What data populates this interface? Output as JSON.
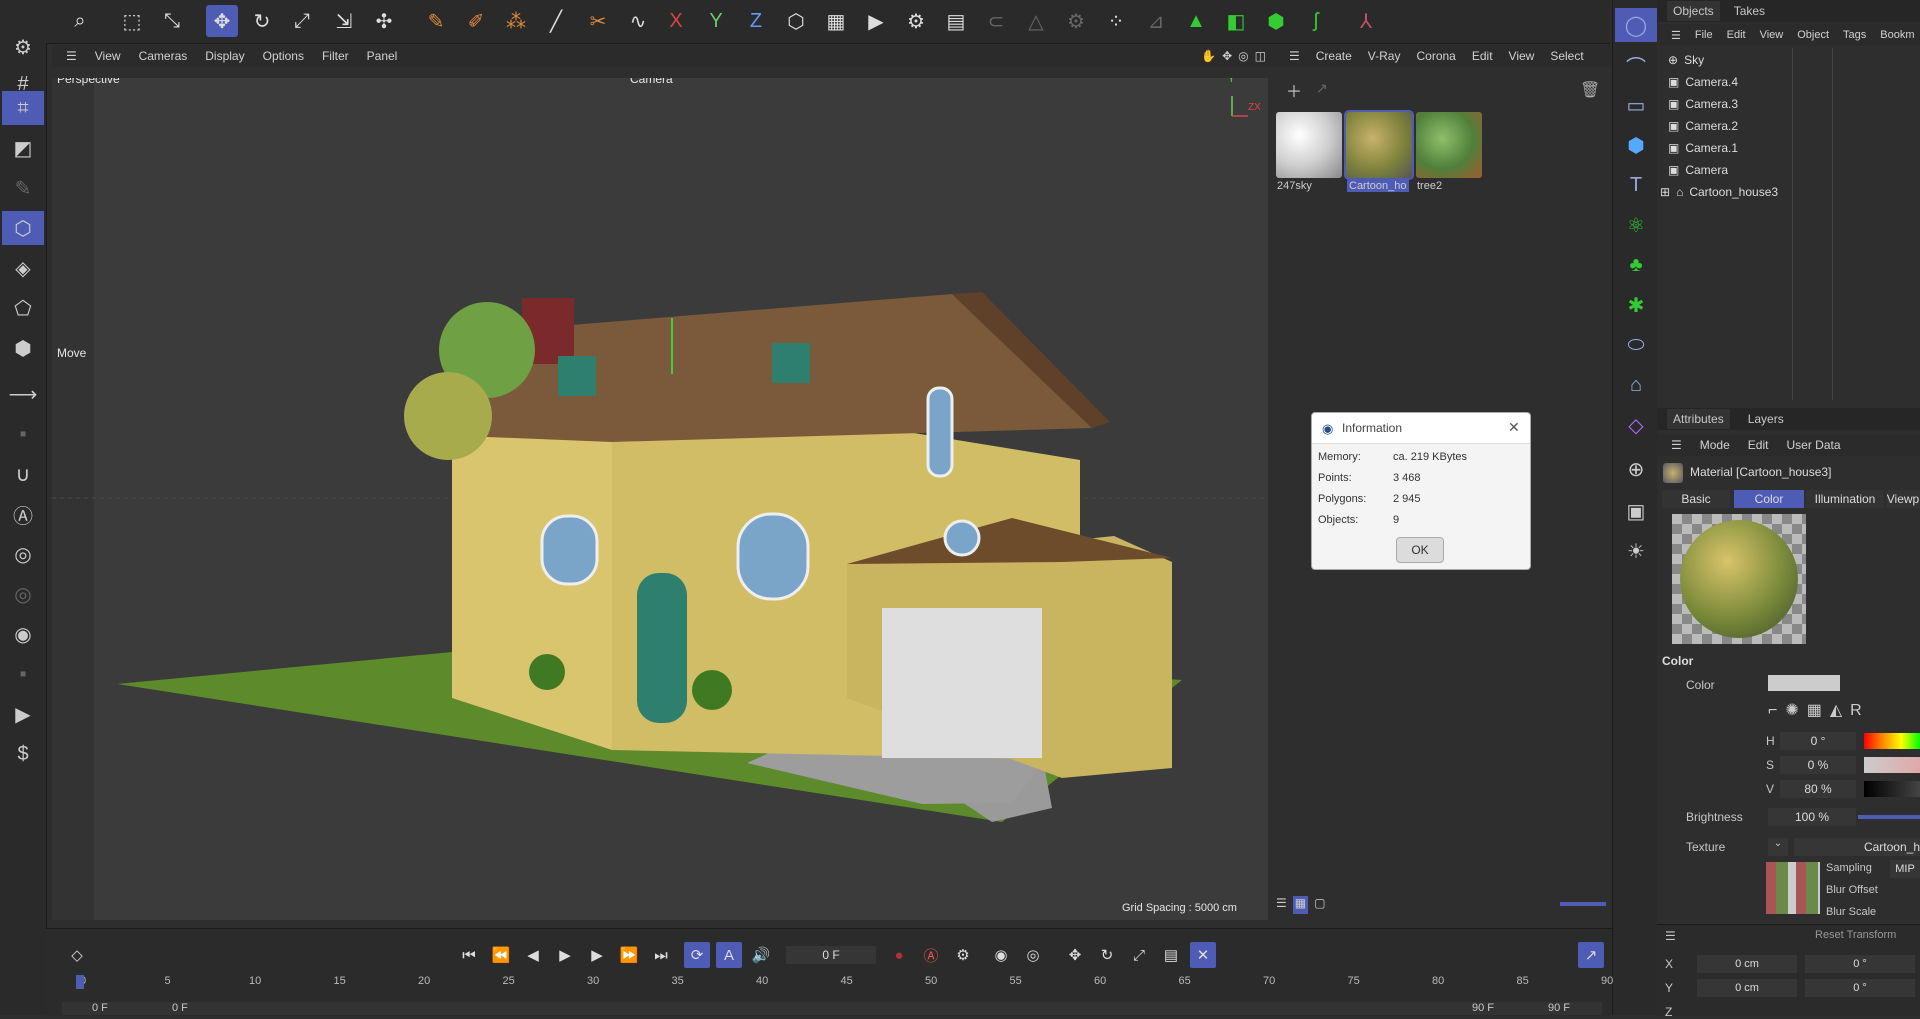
{
  "viewport_menu": [
    "View",
    "Cameras",
    "Display",
    "Options",
    "Filter",
    "Panel"
  ],
  "material_menu": [
    "Create",
    "V-Ray",
    "Corona",
    "Edit",
    "View",
    "Select"
  ],
  "viewport": {
    "name": "Perspective",
    "camera": "Camera",
    "tool": "Move",
    "grid_spacing": "Grid Spacing : 5000 cm",
    "axis_y": "Y",
    "axis_zx": "ZX"
  },
  "materials": [
    {
      "label": "247sky",
      "color": "#e0e0e0"
    },
    {
      "label": "Cartoon_ho",
      "color": "#a39a4a"
    },
    {
      "label": "tree2",
      "color": "#5f9a53"
    }
  ],
  "objects_panel": {
    "tabs": [
      "Objects",
      "Takes"
    ],
    "menu": [
      "File",
      "Edit",
      "View",
      "Object",
      "Tags",
      "Bookm"
    ],
    "items": [
      "Sky",
      "Camera.4",
      "Camera.3",
      "Camera.2",
      "Camera.1",
      "Camera",
      "Cartoon_house3"
    ]
  },
  "info_dialog": {
    "title": "Information",
    "rows": [
      {
        "key": "Memory:",
        "value": "ca. 219 KBytes"
      },
      {
        "key": "Points:",
        "value": "3 468"
      },
      {
        "key": "Polygons:",
        "value": "2 945"
      },
      {
        "key": "Objects:",
        "value": "9"
      }
    ],
    "ok": "OK"
  },
  "attributes": {
    "tabs": [
      "Attributes",
      "Layers"
    ],
    "menu": [
      "Mode",
      "Edit",
      "User Data"
    ],
    "material_title": "Material [Cartoon_house3]",
    "subtabs": [
      "Basic",
      "Color",
      "Illumination",
      "Viewp"
    ],
    "section": "Color",
    "color_label": "Color",
    "h": "0 °",
    "s": "0 %",
    "v": "80 %",
    "brightness_label": "Brightness",
    "brightness": "100 %",
    "texture_label": "Texture",
    "texture_value": "Cartoon_h",
    "sampling_label": "Sampling",
    "sampling_value": "MIP",
    "blur_offset_label": "Blur Offset",
    "blur_scale_label": "Blur Scale",
    "h_label": "H",
    "s_label": "S",
    "v_label": "V"
  },
  "coords": {
    "reset": "Reset Transform",
    "x": "X",
    "y": "Y",
    "z": "Z",
    "pos": "0 cm",
    "rot": "0 °"
  },
  "timeline": {
    "frame": "0 F",
    "start": "0 F",
    "end": "90 F",
    "ticks": [
      "0",
      "5",
      "10",
      "15",
      "20",
      "25",
      "30",
      "35",
      "40",
      "45",
      "50",
      "55",
      "60",
      "65",
      "70",
      "75",
      "80",
      "85",
      "90"
    ]
  },
  "accent_color": "#4e5cb5"
}
